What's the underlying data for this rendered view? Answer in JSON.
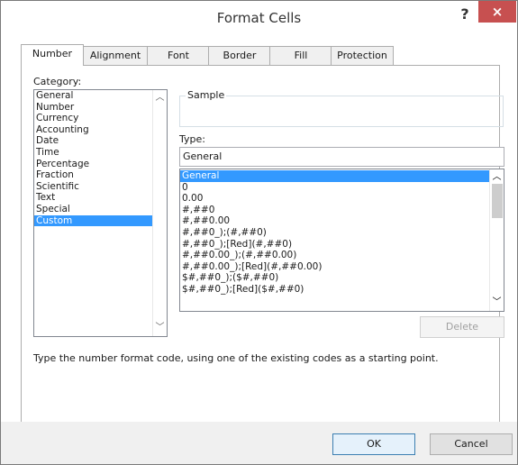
{
  "title": "Format Cells",
  "help_glyph": "?",
  "close_glyph": "×",
  "tabs": [
    "Number",
    "Alignment",
    "Font",
    "Border",
    "Fill",
    "Protection"
  ],
  "category": {
    "label": "Category:",
    "items": [
      "General",
      "Number",
      "Currency",
      "Accounting",
      "Date",
      "Time",
      "Percentage",
      "Fraction",
      "Scientific",
      "Text",
      "Special",
      "Custom"
    ],
    "selected": "Custom"
  },
  "sample": {
    "label": "Sample",
    "value": ""
  },
  "type": {
    "label": "Type:",
    "value": "General",
    "formats": [
      "General",
      "0",
      "0.00",
      "#,##0",
      "#,##0.00",
      "#,##0_);(#,##0)",
      "#,##0_);[Red](#,##0)",
      "#,##0.00_);(#,##0.00)",
      "#,##0.00_);[Red](#,##0.00)",
      "$#,##0_);($#,##0)",
      "$#,##0_);[Red]($#,##0)"
    ],
    "selected": "General"
  },
  "delete_label": "Delete",
  "hint": "Type the number format code, using one of the existing codes as a starting point.",
  "ok_label": "OK",
  "cancel_label": "Cancel",
  "colors": {
    "selection": "#3399ff",
    "close": "#c75050"
  }
}
